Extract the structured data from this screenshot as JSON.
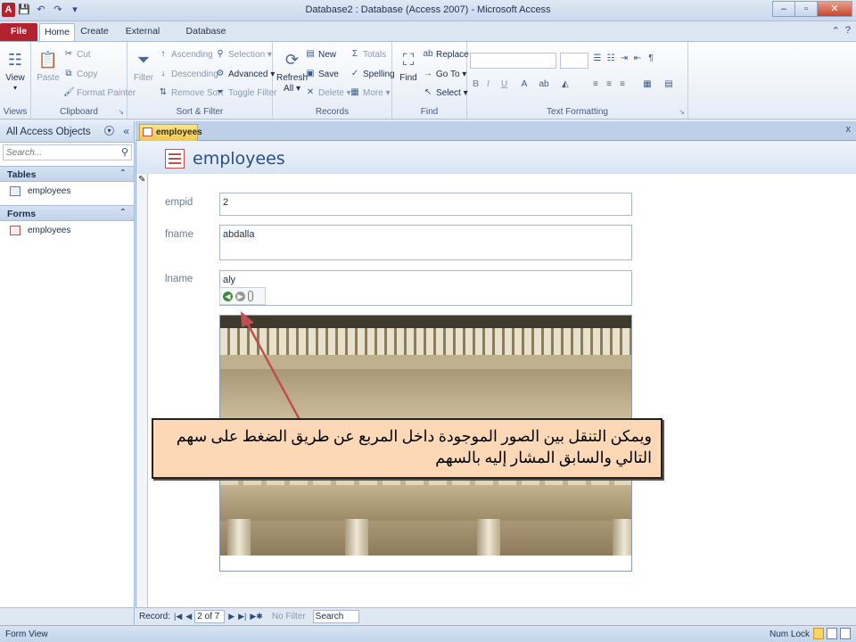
{
  "window": {
    "title": "Database2 : Database (Access 2007) - Microsoft Access",
    "app_icon": "A",
    "controls": {
      "minimize": "–",
      "maximize": "▫",
      "close": "✕"
    }
  },
  "ribbon_tabs": {
    "file": "File",
    "home": "Home",
    "create": "Create",
    "external": "External Data",
    "dbtools": "Database Tools"
  },
  "ribbon": {
    "views": {
      "view": "View",
      "group": "Views"
    },
    "clipboard": {
      "paste": "Paste",
      "cut": "Cut",
      "copy": "Copy",
      "format_painter": "Format Painter",
      "group": "Clipboard"
    },
    "sort_filter": {
      "filter": "Filter",
      "ascending": "Ascending",
      "descending": "Descending",
      "remove_sort": "Remove Sort",
      "selection": "Selection ▾",
      "advanced": "Advanced ▾",
      "toggle_filter": "Toggle Filter",
      "group": "Sort & Filter"
    },
    "records": {
      "refresh": "Refresh",
      "refresh_all": "All ▾",
      "new": "New",
      "save": "Save",
      "delete": "Delete ▾",
      "totals": "Totals",
      "spelling": "Spelling",
      "more": "More ▾",
      "group": "Records"
    },
    "find": {
      "find": "Find",
      "replace": "Replace",
      "goto": "Go To ▾",
      "select": "Select ▾",
      "group": "Find"
    },
    "text_formatting": {
      "group": "Text Formatting",
      "bold": "B",
      "italic": "I",
      "underline": "U"
    }
  },
  "nav": {
    "header": "All Access Objects",
    "search_placeholder": "Search...",
    "tables_section": "Tables",
    "tables": [
      {
        "label": "employees"
      }
    ],
    "forms_section": "Forms",
    "forms": [
      {
        "label": "employees"
      }
    ]
  },
  "document": {
    "tab_label": "employees",
    "form_title": "employees",
    "fields": {
      "empid": {
        "label": "empid",
        "value": "2"
      },
      "fname": {
        "label": "fname",
        "value": "abdalla"
      },
      "lname": {
        "label": "lname",
        "value": "aly"
      }
    }
  },
  "callout": {
    "text": "ويمكن التنقل بين الصور الموجودة داخل المربع عن طريق الضغط على سهم التالي والسابق المشار إليه بالسهم"
  },
  "record_nav": {
    "label": "Record:",
    "current": "2 of 7",
    "no_filter": "No Filter",
    "search": "Search"
  },
  "status": {
    "left": "Form View",
    "right": "Num Lock"
  },
  "colors": {
    "file_tab": "#b3232f",
    "doc_tab": "#f1c94b",
    "callout_bg": "#fcd8b7",
    "arrow": "#c0504d"
  }
}
